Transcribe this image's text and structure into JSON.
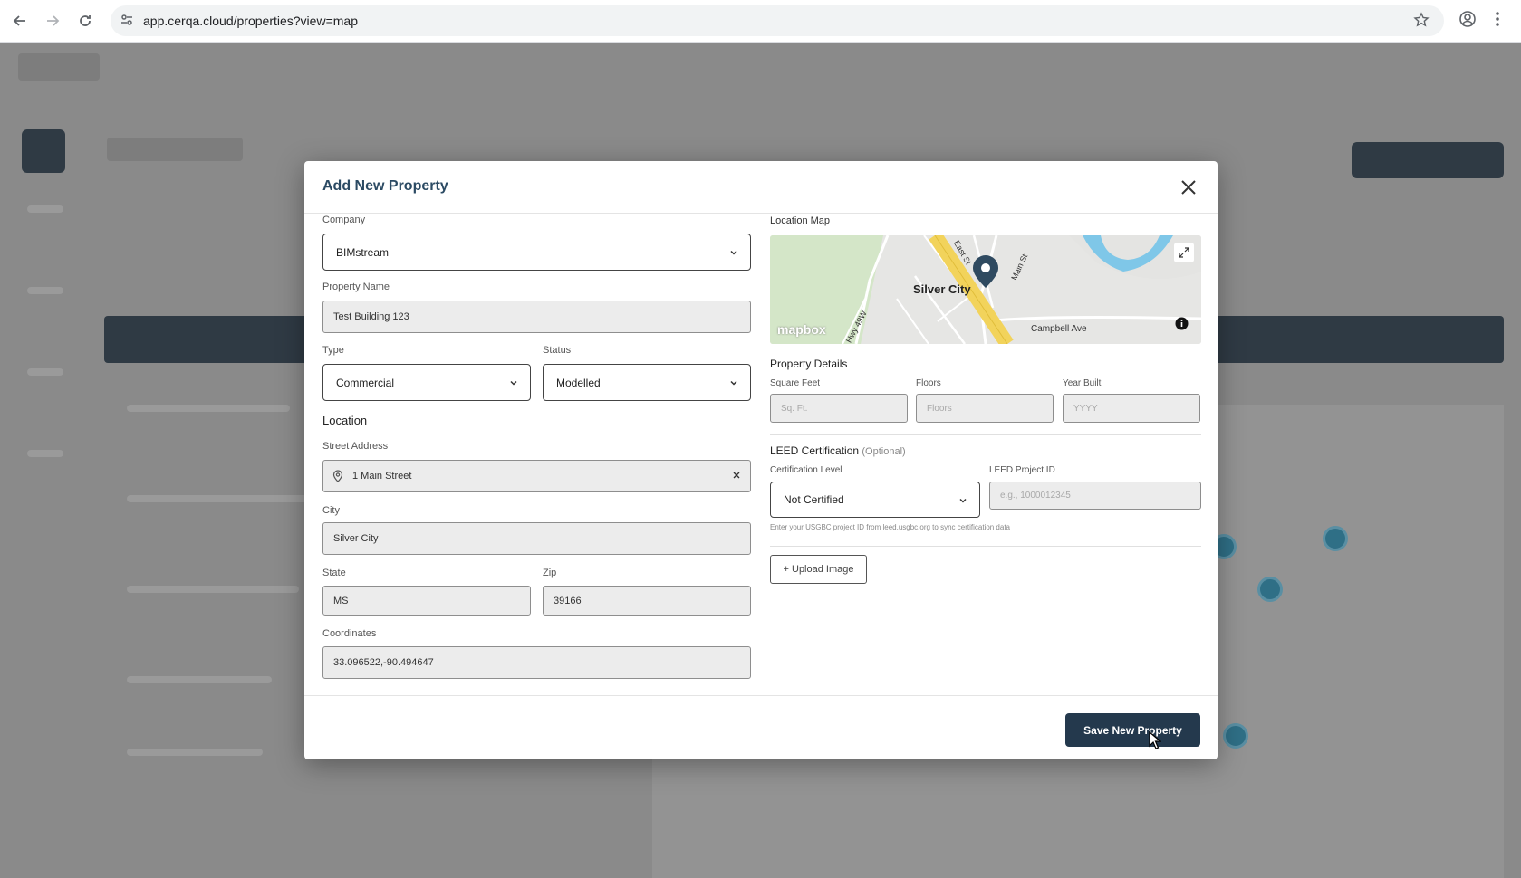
{
  "browser": {
    "url": "app.cerqa.cloud/properties?view=map"
  },
  "modal": {
    "title": "Add New Property",
    "company": {
      "label": "Company",
      "value": "BIMstream"
    },
    "property_name": {
      "label": "Property Name",
      "value": "Test Building 123"
    },
    "type": {
      "label": "Type",
      "value": "Commercial"
    },
    "status": {
      "label": "Status",
      "value": "Modelled"
    },
    "location": {
      "heading": "Location",
      "street_label": "Street Address",
      "street_value": "1 Main Street",
      "city_label": "City",
      "city_value": "Silver City",
      "state_label": "State",
      "state_value": "MS",
      "zip_label": "Zip",
      "zip_value": "39166",
      "coordinates_label": "Coordinates",
      "coordinates_value": "33.096522,-90.494647"
    },
    "location_map": {
      "heading": "Location Map",
      "place_label": "Silver City",
      "streets": [
        "East St",
        "Main St",
        "Campbell Ave",
        "Hwy 49W"
      ],
      "attribution": "mapbox"
    },
    "property_details": {
      "heading": "Property Details",
      "sqft_label": "Square Feet",
      "sqft_placeholder": "Sq. Ft.",
      "floors_label": "Floors",
      "floors_placeholder": "Floors",
      "year_label": "Year Built",
      "year_placeholder": "YYYY"
    },
    "leed": {
      "heading": "LEED Certification",
      "optional": "(Optional)",
      "level_label": "Certification Level",
      "level_value": "Not Certified",
      "project_id_label": "LEED Project ID",
      "project_id_placeholder": "e.g., 1000012345",
      "hint": "Enter your USGBC project ID from leed.usgbc.org to sync certification data"
    },
    "upload_label": "+ Upload Image",
    "save_label": "Save New Property"
  },
  "colors": {
    "primary": "#24394d",
    "title": "#2b4a63",
    "map_marker": "#2f4a60",
    "highway": "#f2d35b",
    "water": "#7fc7e8"
  }
}
